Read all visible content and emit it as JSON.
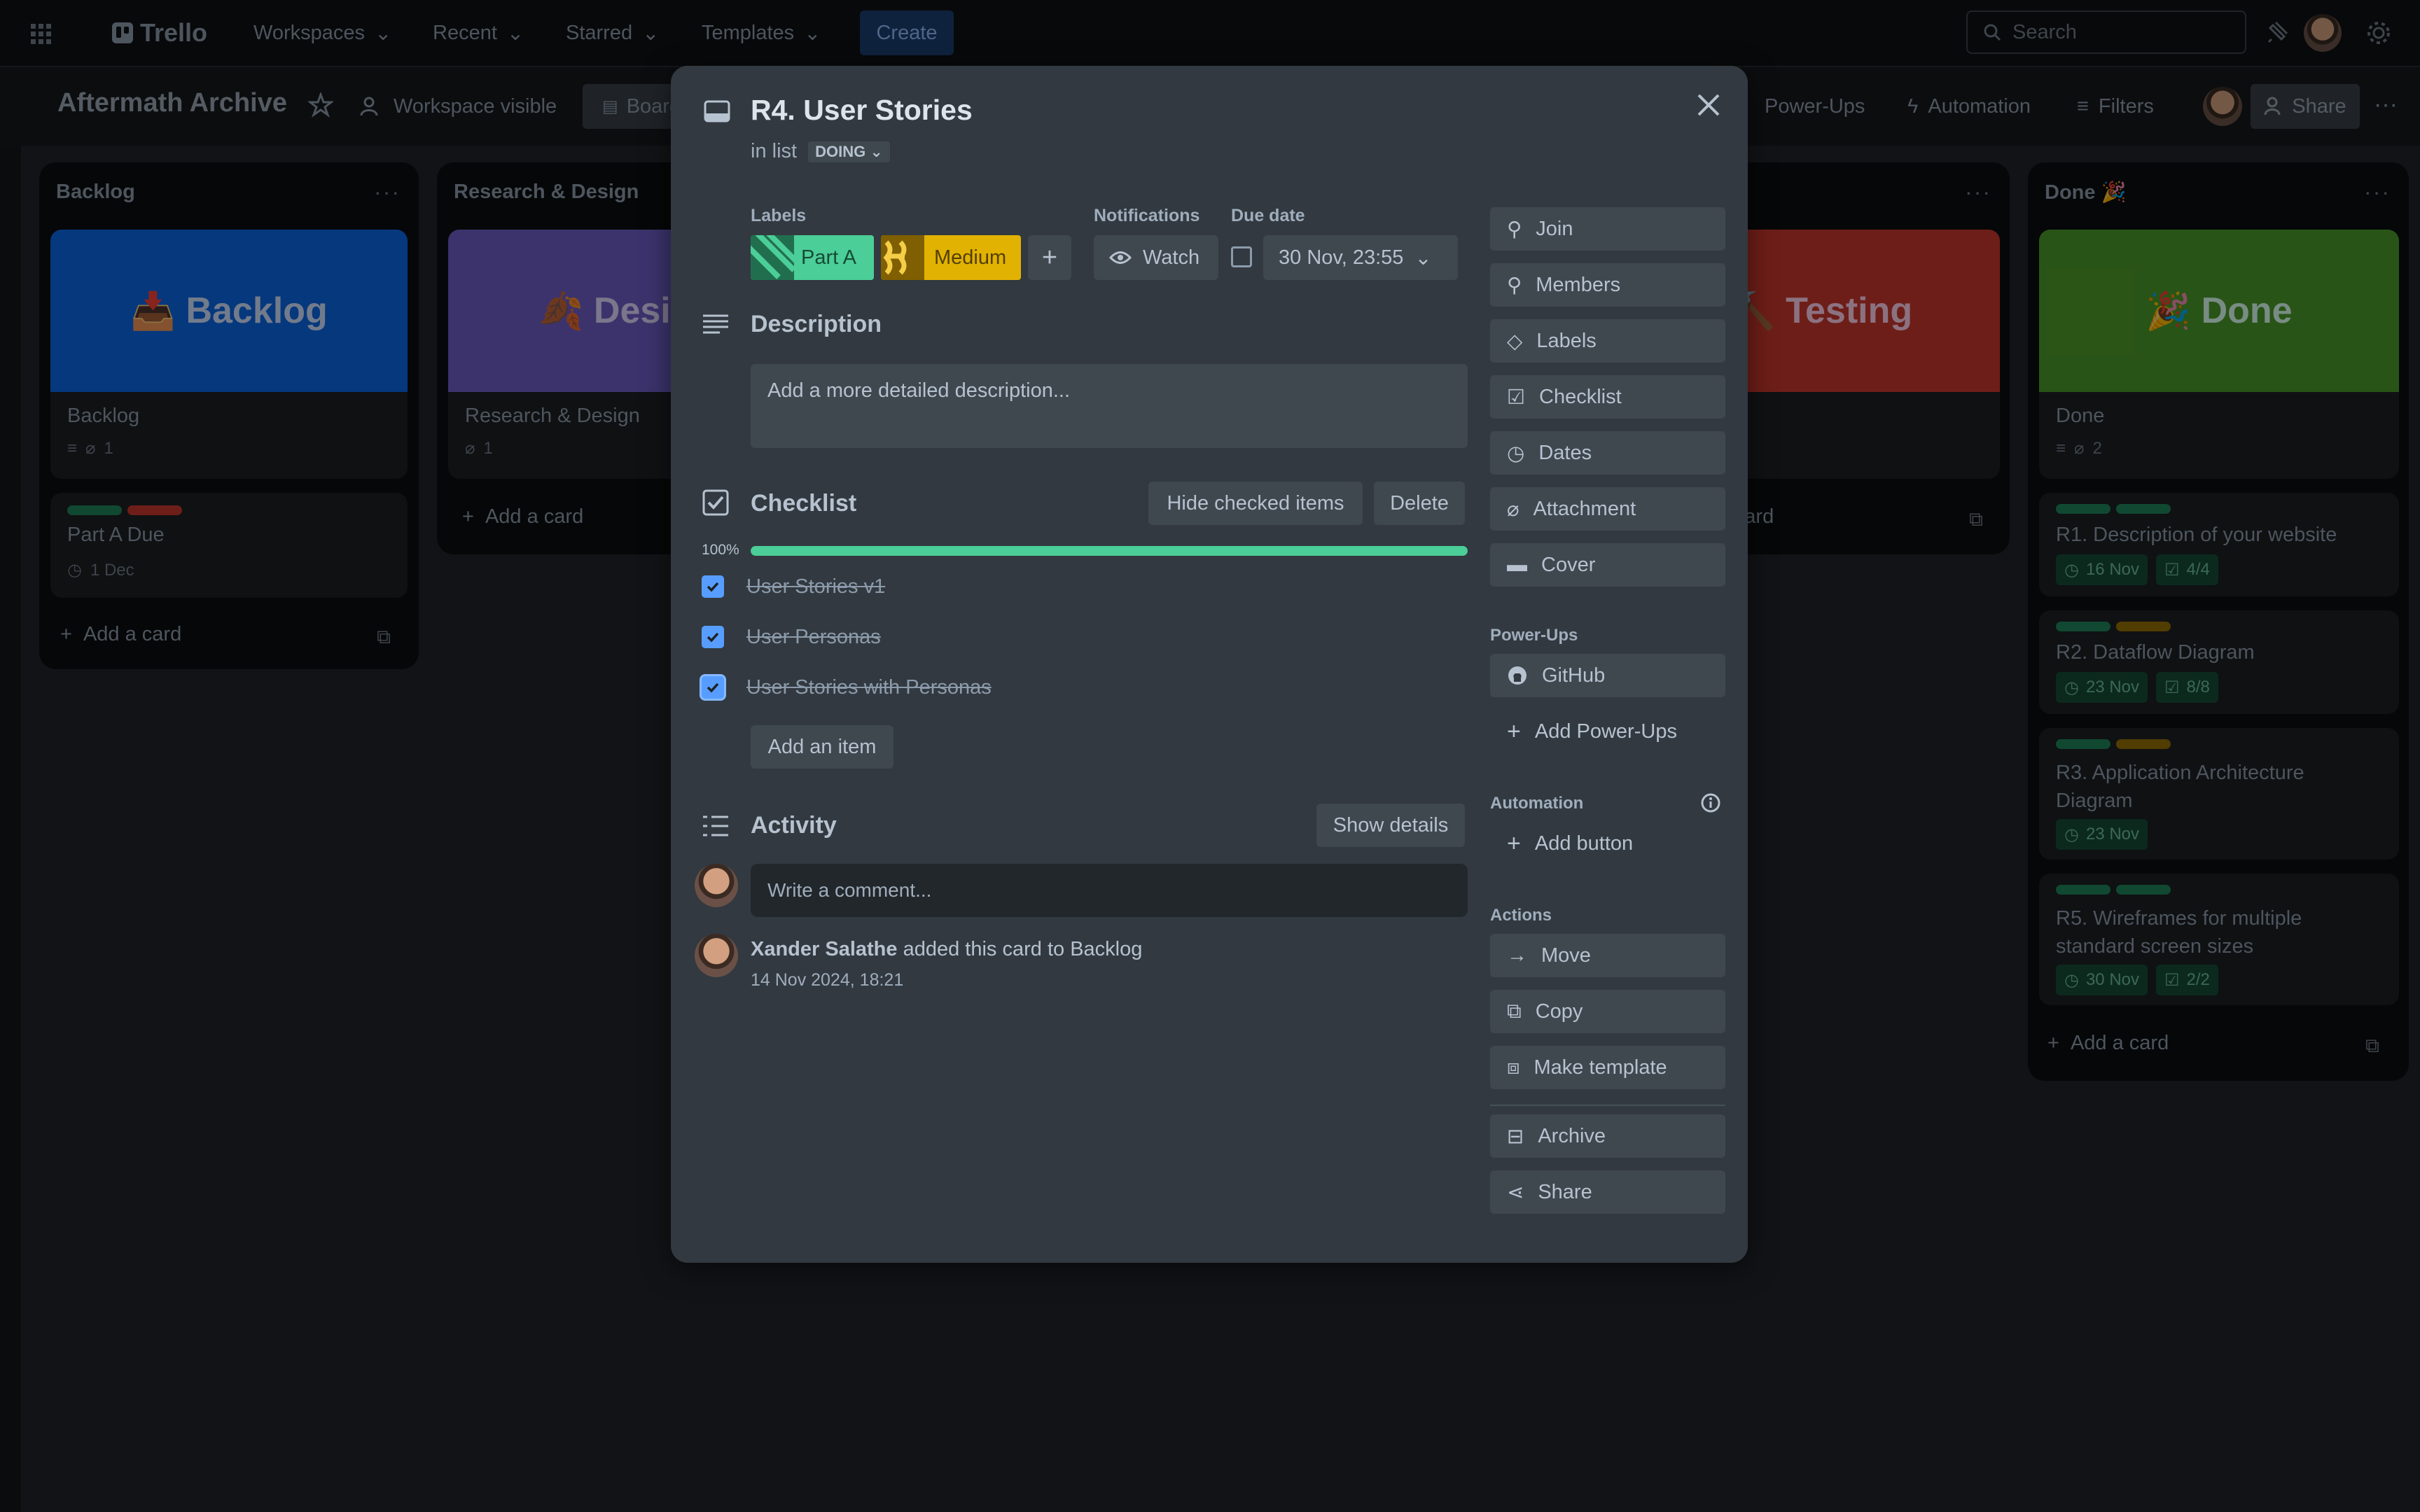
{
  "topbar": {
    "app_name": "Trello",
    "menus": [
      "Workspaces",
      "Recent",
      "Starred",
      "Templates"
    ],
    "create_label": "Create",
    "search_placeholder": "Search"
  },
  "board": {
    "title": "Aftermath Archive",
    "visibility": "Workspace visible",
    "view_label": "Board",
    "powerups_label": "Power-Ups",
    "automation_label": "Automation",
    "filters_label": "Filters",
    "share_label": "Share"
  },
  "lists": [
    {
      "title": "Backlog",
      "cover_text": "Backlog",
      "cover_color": "#0c66e4",
      "card_title": "Backlog",
      "attachments": "1",
      "second_card": {
        "title": "Part A Due",
        "due": "1 Dec"
      },
      "add_card": "Add a card"
    },
    {
      "title": "Research & Design",
      "cover_text": "Design",
      "cover_color": "#7f5f01",
      "card_title": "Research & Design",
      "attachments": "1",
      "add_card": "Add a card"
    },
    {
      "title": "",
      "cover_text": "Testing",
      "cover_color": "#c9372c",
      "add_card": "Add a card"
    },
    {
      "title": "Done 🎉",
      "cover_text": "Done",
      "cover_color": "#4c9a2a",
      "card_title": "Done",
      "attachments": "2",
      "cards": [
        {
          "title": "R1. Description of your website",
          "due": "16 Nov",
          "checklist": "4/4"
        },
        {
          "title": "R2. Dataflow Diagram",
          "due": "23 Nov",
          "checklist": "8/8"
        },
        {
          "title": "R3. Application Architecture Diagram",
          "due": "23 Nov"
        },
        {
          "title": "R5. Wireframes for multiple standard screen sizes",
          "due": "30 Nov",
          "checklist": "2/2"
        }
      ],
      "add_card": "Add a card"
    }
  ],
  "modal": {
    "title": "R4. User Stories",
    "in_list_prefix": "in list",
    "list_name": "DOING",
    "labels_heading": "Labels",
    "labels": [
      {
        "name": "Part A",
        "color": "#4bce97"
      },
      {
        "name": "Medium",
        "color": "#e2b203"
      }
    ],
    "notifications_heading": "Notifications",
    "watch_label": "Watch",
    "due_heading": "Due date",
    "due_value": "30 Nov, 23:55",
    "description_heading": "Description",
    "description_placeholder": "Add a more detailed description...",
    "checklist": {
      "heading": "Checklist",
      "hide_label": "Hide checked items",
      "delete_label": "Delete",
      "progress_text": "100%",
      "progress": 1.0,
      "items": [
        "User Stories v1",
        "User Personas",
        "User Stories with Personas"
      ],
      "add_item": "Add an item"
    },
    "activity": {
      "heading": "Activity",
      "show_details": "Show details",
      "comment_placeholder": "Write a comment...",
      "entries": [
        {
          "user": "Xander Salathe",
          "text": "added this card to Backlog",
          "time": "14 Nov 2024, 18:21"
        }
      ]
    },
    "sidebar": {
      "add_to_card": [
        "Join",
        "Members",
        "Labels",
        "Checklist",
        "Dates",
        "Attachment",
        "Cover"
      ],
      "powerups_heading": "Power-Ups",
      "github": "GitHub",
      "add_powerups": "Add Power-Ups",
      "automation_heading": "Automation",
      "add_button": "Add button",
      "actions_heading": "Actions",
      "actions": [
        "Move",
        "Copy",
        "Make template",
        "Archive",
        "Share"
      ]
    }
  }
}
